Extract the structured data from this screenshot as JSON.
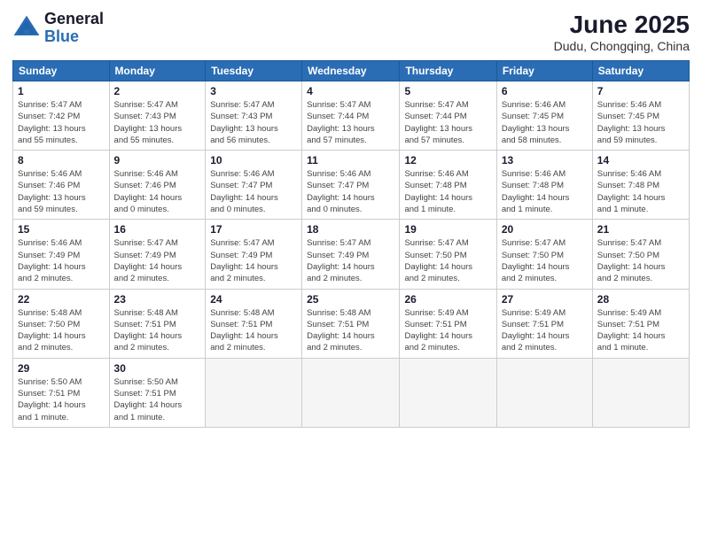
{
  "header": {
    "logo_general": "General",
    "logo_blue": "Blue",
    "month_title": "June 2025",
    "location": "Dudu, Chongqing, China"
  },
  "weekdays": [
    "Sunday",
    "Monday",
    "Tuesday",
    "Wednesday",
    "Thursday",
    "Friday",
    "Saturday"
  ],
  "weeks": [
    [
      {
        "day": "1",
        "info": "Sunrise: 5:47 AM\nSunset: 7:42 PM\nDaylight: 13 hours\nand 55 minutes."
      },
      {
        "day": "2",
        "info": "Sunrise: 5:47 AM\nSunset: 7:43 PM\nDaylight: 13 hours\nand 55 minutes."
      },
      {
        "day": "3",
        "info": "Sunrise: 5:47 AM\nSunset: 7:43 PM\nDaylight: 13 hours\nand 56 minutes."
      },
      {
        "day": "4",
        "info": "Sunrise: 5:47 AM\nSunset: 7:44 PM\nDaylight: 13 hours\nand 57 minutes."
      },
      {
        "day": "5",
        "info": "Sunrise: 5:47 AM\nSunset: 7:44 PM\nDaylight: 13 hours\nand 57 minutes."
      },
      {
        "day": "6",
        "info": "Sunrise: 5:46 AM\nSunset: 7:45 PM\nDaylight: 13 hours\nand 58 minutes."
      },
      {
        "day": "7",
        "info": "Sunrise: 5:46 AM\nSunset: 7:45 PM\nDaylight: 13 hours\nand 59 minutes."
      }
    ],
    [
      {
        "day": "8",
        "info": "Sunrise: 5:46 AM\nSunset: 7:46 PM\nDaylight: 13 hours\nand 59 minutes."
      },
      {
        "day": "9",
        "info": "Sunrise: 5:46 AM\nSunset: 7:46 PM\nDaylight: 14 hours\nand 0 minutes."
      },
      {
        "day": "10",
        "info": "Sunrise: 5:46 AM\nSunset: 7:47 PM\nDaylight: 14 hours\nand 0 minutes."
      },
      {
        "day": "11",
        "info": "Sunrise: 5:46 AM\nSunset: 7:47 PM\nDaylight: 14 hours\nand 0 minutes."
      },
      {
        "day": "12",
        "info": "Sunrise: 5:46 AM\nSunset: 7:48 PM\nDaylight: 14 hours\nand 1 minute."
      },
      {
        "day": "13",
        "info": "Sunrise: 5:46 AM\nSunset: 7:48 PM\nDaylight: 14 hours\nand 1 minute."
      },
      {
        "day": "14",
        "info": "Sunrise: 5:46 AM\nSunset: 7:48 PM\nDaylight: 14 hours\nand 1 minute."
      }
    ],
    [
      {
        "day": "15",
        "info": "Sunrise: 5:46 AM\nSunset: 7:49 PM\nDaylight: 14 hours\nand 2 minutes."
      },
      {
        "day": "16",
        "info": "Sunrise: 5:47 AM\nSunset: 7:49 PM\nDaylight: 14 hours\nand 2 minutes."
      },
      {
        "day": "17",
        "info": "Sunrise: 5:47 AM\nSunset: 7:49 PM\nDaylight: 14 hours\nand 2 minutes."
      },
      {
        "day": "18",
        "info": "Sunrise: 5:47 AM\nSunset: 7:49 PM\nDaylight: 14 hours\nand 2 minutes."
      },
      {
        "day": "19",
        "info": "Sunrise: 5:47 AM\nSunset: 7:50 PM\nDaylight: 14 hours\nand 2 minutes."
      },
      {
        "day": "20",
        "info": "Sunrise: 5:47 AM\nSunset: 7:50 PM\nDaylight: 14 hours\nand 2 minutes."
      },
      {
        "day": "21",
        "info": "Sunrise: 5:47 AM\nSunset: 7:50 PM\nDaylight: 14 hours\nand 2 minutes."
      }
    ],
    [
      {
        "day": "22",
        "info": "Sunrise: 5:48 AM\nSunset: 7:50 PM\nDaylight: 14 hours\nand 2 minutes."
      },
      {
        "day": "23",
        "info": "Sunrise: 5:48 AM\nSunset: 7:51 PM\nDaylight: 14 hours\nand 2 minutes."
      },
      {
        "day": "24",
        "info": "Sunrise: 5:48 AM\nSunset: 7:51 PM\nDaylight: 14 hours\nand 2 minutes."
      },
      {
        "day": "25",
        "info": "Sunrise: 5:48 AM\nSunset: 7:51 PM\nDaylight: 14 hours\nand 2 minutes."
      },
      {
        "day": "26",
        "info": "Sunrise: 5:49 AM\nSunset: 7:51 PM\nDaylight: 14 hours\nand 2 minutes."
      },
      {
        "day": "27",
        "info": "Sunrise: 5:49 AM\nSunset: 7:51 PM\nDaylight: 14 hours\nand 2 minutes."
      },
      {
        "day": "28",
        "info": "Sunrise: 5:49 AM\nSunset: 7:51 PM\nDaylight: 14 hours\nand 1 minute."
      }
    ],
    [
      {
        "day": "29",
        "info": "Sunrise: 5:50 AM\nSunset: 7:51 PM\nDaylight: 14 hours\nand 1 minute."
      },
      {
        "day": "30",
        "info": "Sunrise: 5:50 AM\nSunset: 7:51 PM\nDaylight: 14 hours\nand 1 minute."
      },
      {
        "day": "",
        "info": ""
      },
      {
        "day": "",
        "info": ""
      },
      {
        "day": "",
        "info": ""
      },
      {
        "day": "",
        "info": ""
      },
      {
        "day": "",
        "info": ""
      }
    ]
  ]
}
